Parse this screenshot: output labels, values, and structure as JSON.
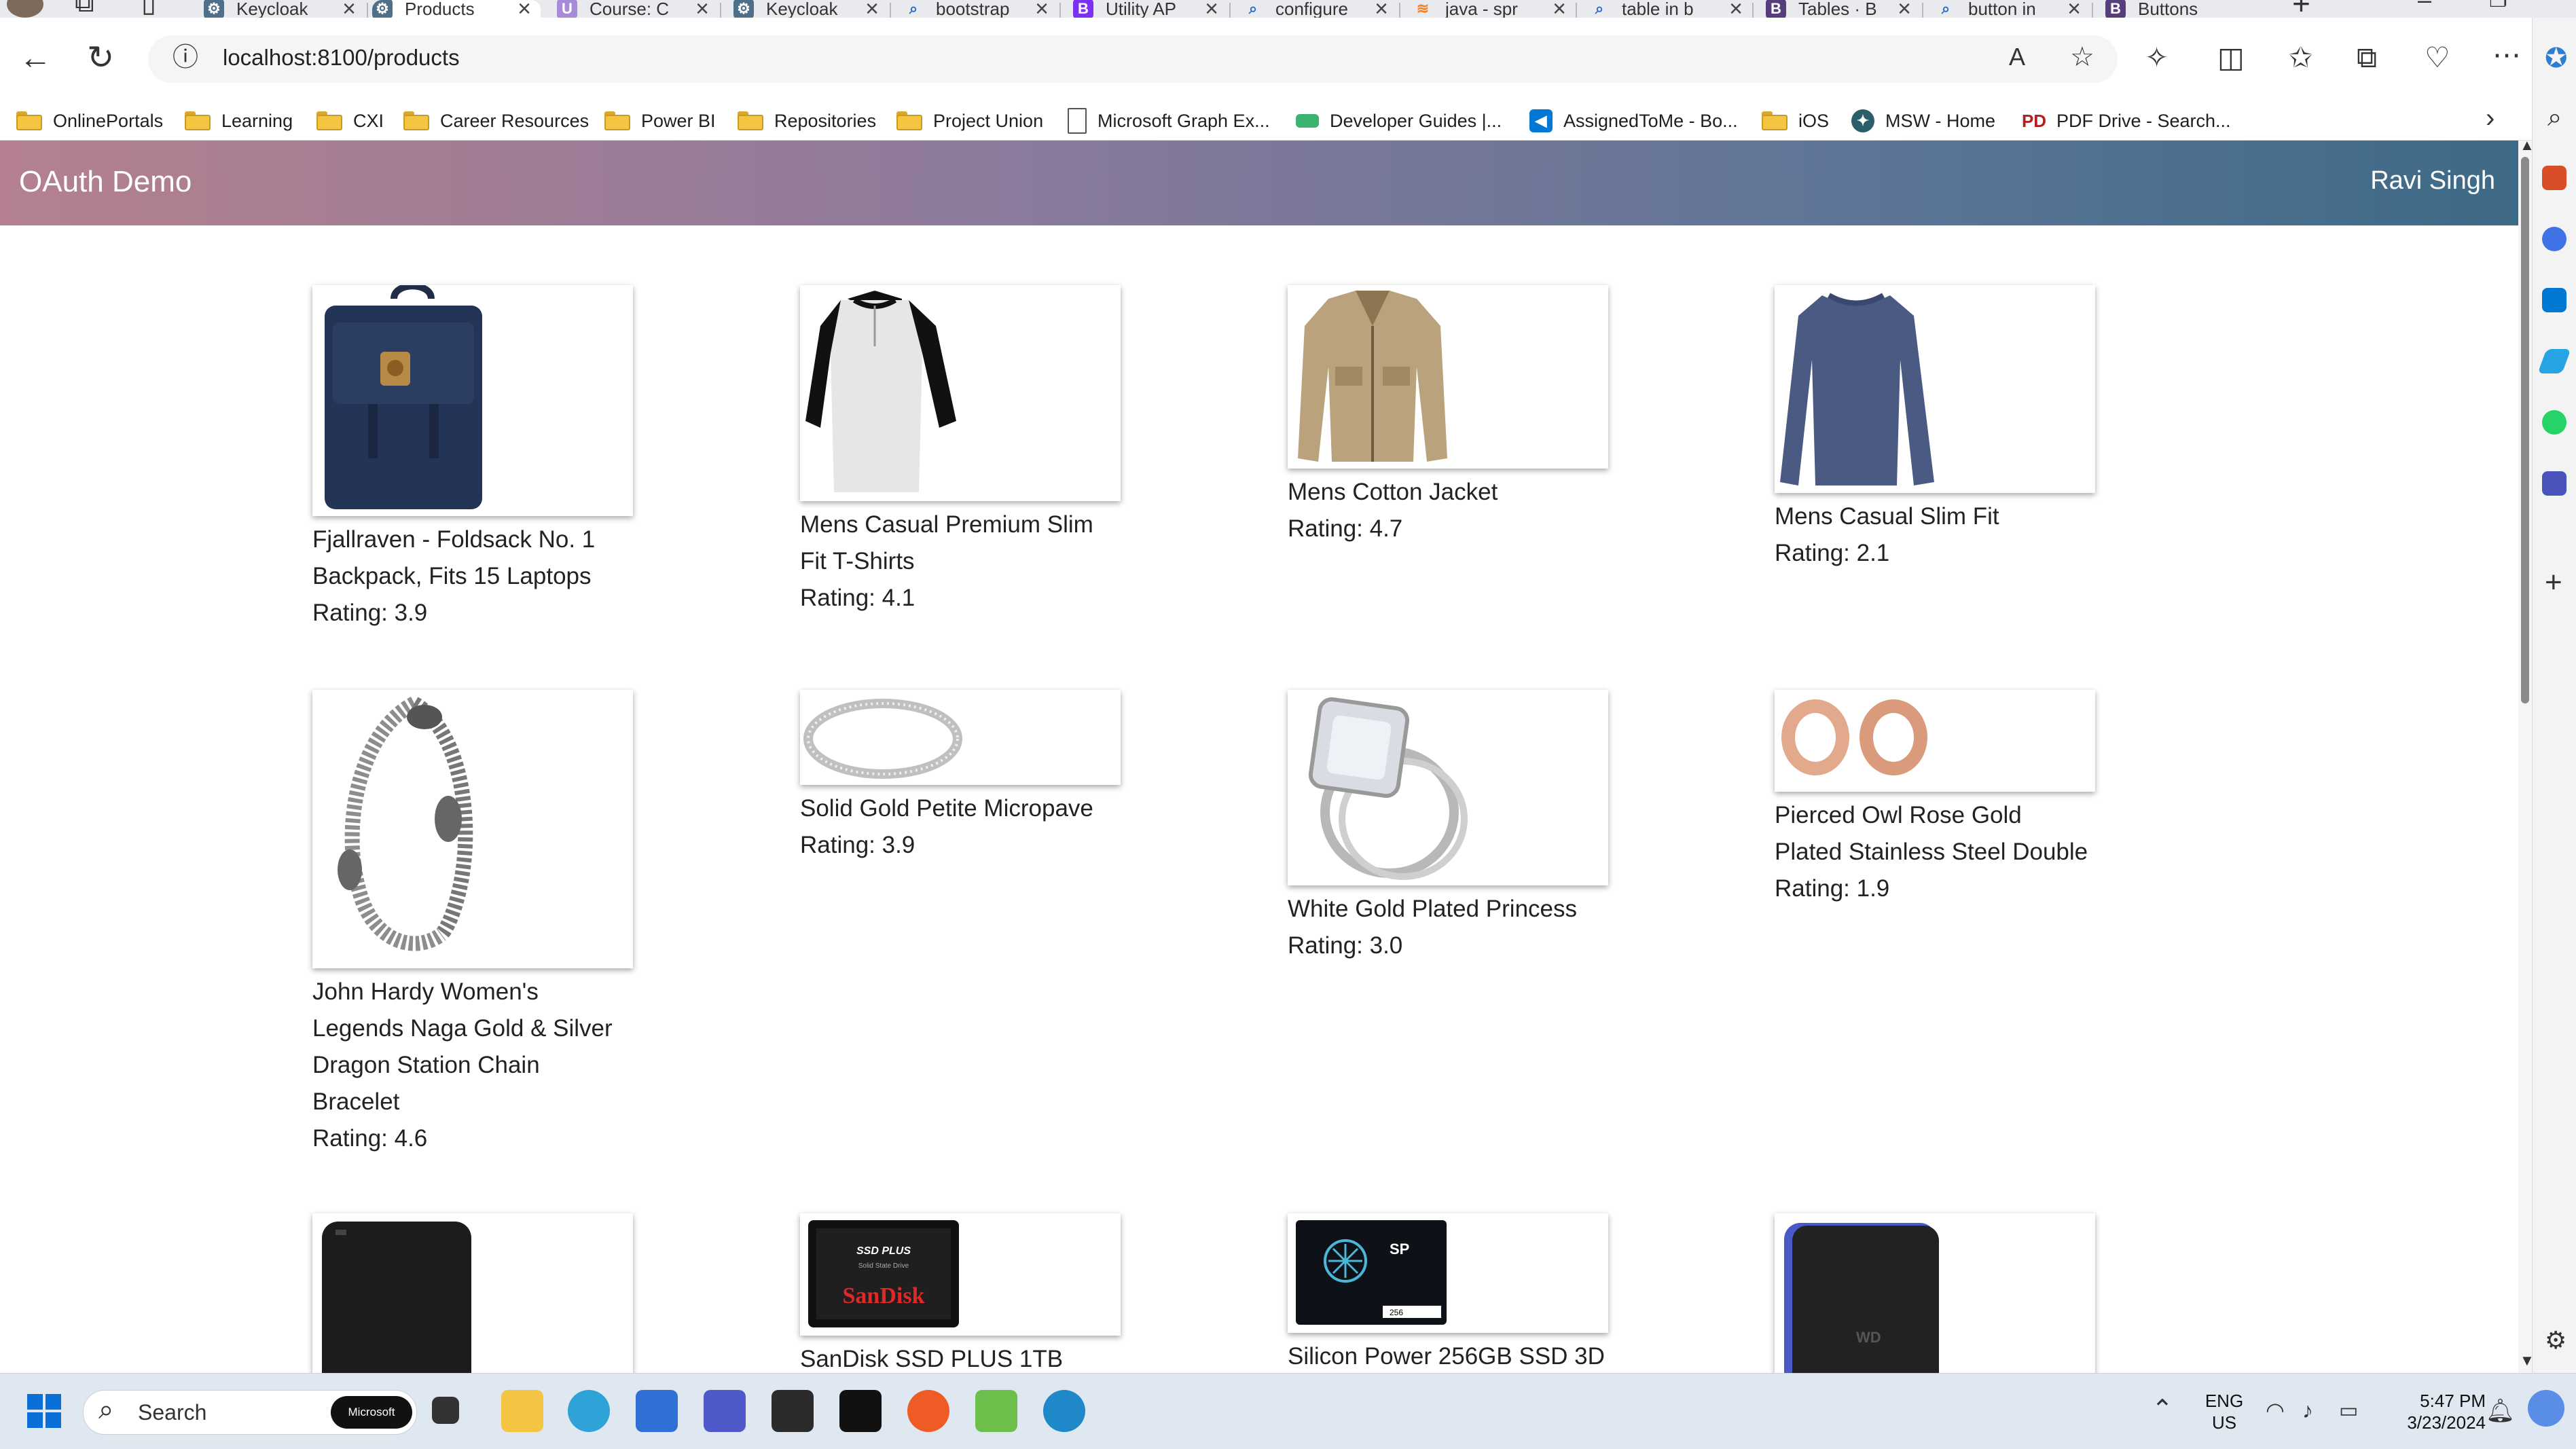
{
  "tabs": [
    {
      "label": "Keycloak",
      "active": false
    },
    {
      "label": "Products",
      "active": true
    },
    {
      "label": "Course: C",
      "active": false
    },
    {
      "label": "Keycloak",
      "active": false
    },
    {
      "label": "bootstrap",
      "active": false
    },
    {
      "label": "Utility AP",
      "active": false
    },
    {
      "label": "configure",
      "active": false
    },
    {
      "label": "java - spr",
      "active": false
    },
    {
      "label": "table in b",
      "active": false
    },
    {
      "label": "Tables · B",
      "active": false
    },
    {
      "label": "button in",
      "active": false
    },
    {
      "label": "Buttons",
      "active": false
    }
  ],
  "address_bar": {
    "url": "localhost:8100/products"
  },
  "bookmarks": [
    {
      "label": "OnlinePortals",
      "type": "folder"
    },
    {
      "label": "Learning",
      "type": "folder"
    },
    {
      "label": "CXI",
      "type": "folder"
    },
    {
      "label": "Career Resources",
      "type": "folder"
    },
    {
      "label": "Power BI",
      "type": "folder"
    },
    {
      "label": "Repositories",
      "type": "folder"
    },
    {
      "label": "Project Union",
      "type": "folder"
    },
    {
      "label": "Microsoft Graph Ex...",
      "type": "page"
    },
    {
      "label": "Developer Guides |...",
      "type": "page"
    },
    {
      "label": "AssignedToMe - Bo...",
      "type": "page"
    },
    {
      "label": "iOS",
      "type": "folder"
    },
    {
      "label": "MSW - Home",
      "type": "page"
    },
    {
      "label": "PDF Drive - Search...",
      "type": "page"
    }
  ],
  "app": {
    "brand": "OAuth Demo",
    "user": "Ravi Singh"
  },
  "products": [
    {
      "title": "Fjallraven - Foldsack No. 1 Backpack, Fits 15 Laptops",
      "rating": "Rating: 3.9",
      "image": "backpack"
    },
    {
      "title": "Mens Casual Premium Slim Fit T-Shirts",
      "rating": "Rating: 4.1",
      "image": "henley-shirt"
    },
    {
      "title": "Mens Cotton Jacket",
      "rating": "Rating: 4.7",
      "image": "cotton-jacket"
    },
    {
      "title": "Mens Casual Slim Fit",
      "rating": "Rating: 2.1",
      "image": "slim-fit-shirt"
    },
    {
      "title": "John Hardy Women's Legends Naga Gold & Silver Dragon Station Chain Bracelet",
      "rating": "Rating: 4.6",
      "image": "dragon-bracelet"
    },
    {
      "title": "Solid Gold Petite Micropave",
      "rating": "Rating: 3.9",
      "image": "micropave-ring"
    },
    {
      "title": "White Gold Plated Princess",
      "rating": "Rating: 3.0",
      "image": "princess-ring"
    },
    {
      "title": "Pierced Owl Rose Gold Plated Stainless Steel Double",
      "rating": "Rating: 1.9",
      "image": "rose-gold-plugs"
    },
    {
      "title": "",
      "rating": "",
      "image": "wd-hard-drive"
    },
    {
      "title": "SanDisk SSD PLUS 1TB",
      "rating": "",
      "image": "sandisk-ssd"
    },
    {
      "title": "Silicon Power 256GB SSD 3D",
      "rating": "",
      "image": "silicon-power-ssd"
    },
    {
      "title": "",
      "rating": "",
      "image": "wd-gaming-drive"
    }
  ],
  "product_images": {
    "sandisk_top": "SSD PLUS",
    "sandisk_sub": "Solid State Drive",
    "sandisk_brand": "SanDisk",
    "sp_logo": "SP",
    "sp_capacity": "256",
    "wd_badge": "WD"
  },
  "taskbar": {
    "search_placeholder": "Search",
    "search_badge": "Microsoft",
    "language": "ENG",
    "region": "US",
    "time": "5:47 PM",
    "date": "3/23/2024"
  },
  "colors": {
    "navbar_start": "#b4808f",
    "navbar_end": "#3d6a86",
    "accent": "#0067c0"
  }
}
